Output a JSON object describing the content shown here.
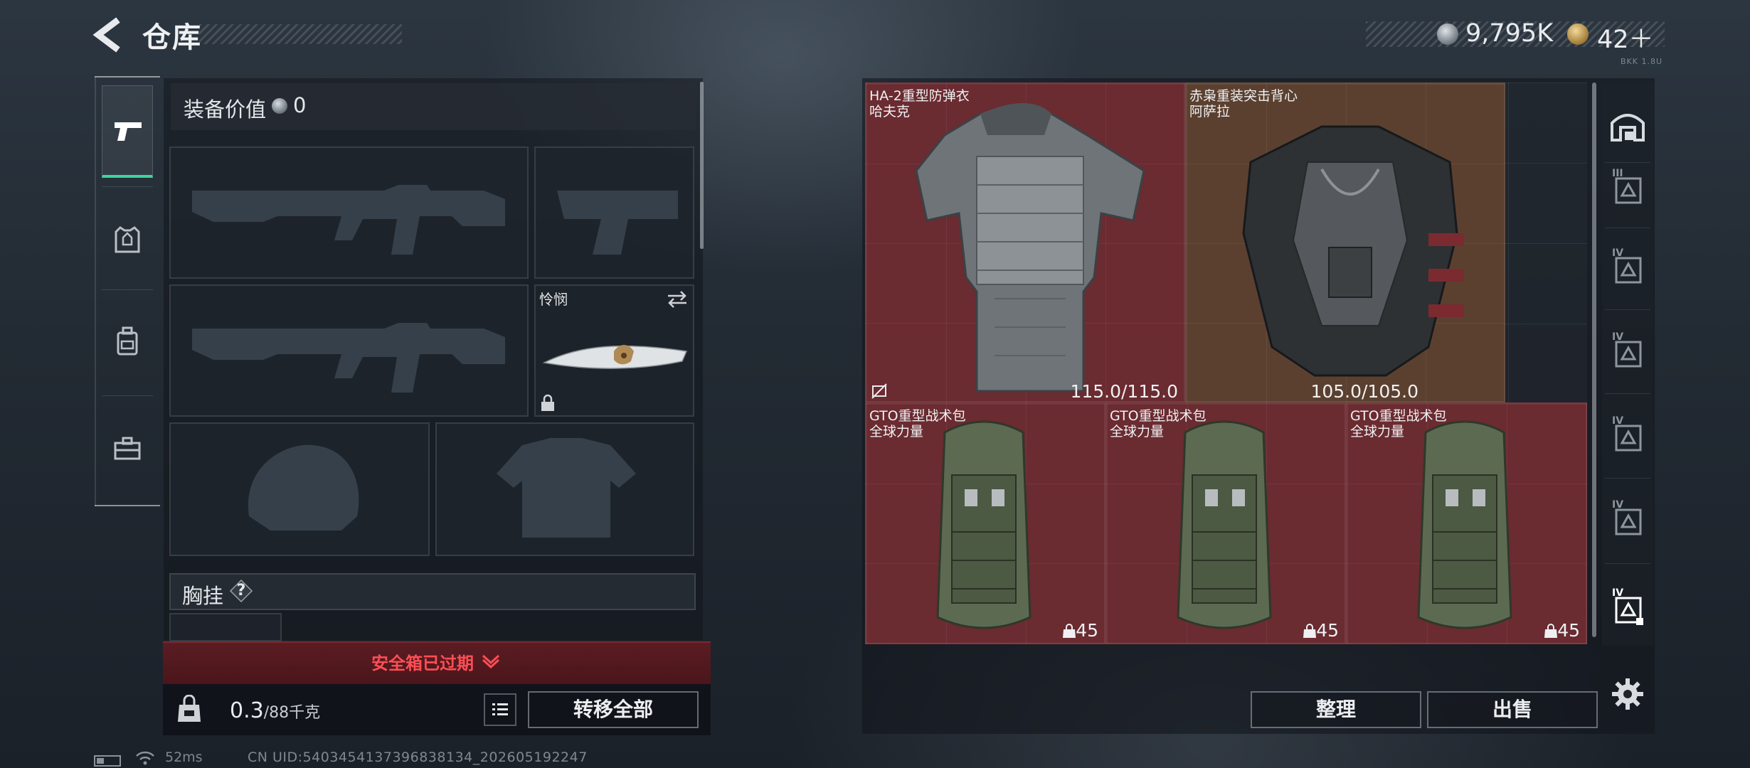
{
  "header": {
    "title": "仓库",
    "currency_silver": "9,795K",
    "currency_gold": "42＋",
    "version_tag": "BKK 1.8U"
  },
  "equipment": {
    "value_label": "装备价值",
    "value": "0",
    "knife_name": "怜悯",
    "chest_rig_label": "胸挂",
    "chest_rig_help": "?"
  },
  "safe_box": {
    "status": "安全箱已过期"
  },
  "backpack": {
    "weight_current": "0.3",
    "weight_max": "/88千克",
    "transfer_all": "转移全部"
  },
  "storage": {
    "items": [
      {
        "name": "HA-2重型防弹衣",
        "brand": "哈夫克",
        "durability": "115.0/115.0"
      },
      {
        "name": "赤枭重装突击背心",
        "brand": "阿萨拉",
        "durability": "105.0/105.0"
      },
      {
        "name": "GTO重型战术包",
        "brand": "全球力量",
        "capacity": "45"
      },
      {
        "name": "GTO重型战术包",
        "brand": "全球力量",
        "capacity": "45"
      },
      {
        "name": "GTO重型战术包",
        "brand": "全球力量",
        "capacity": "45"
      }
    ],
    "sort_button": "整理",
    "sell_button": "出售"
  },
  "right_tabs": [
    {
      "icon": "stash-icon"
    },
    {
      "icon": "storage-iii-icon",
      "label": "III"
    },
    {
      "icon": "storage-iv-icon",
      "label": "IV"
    },
    {
      "icon": "storage-iv-icon",
      "label": "IV"
    },
    {
      "icon": "storage-iv-icon",
      "label": "IV"
    },
    {
      "icon": "storage-iv-icon",
      "label": "IV"
    },
    {
      "icon": "storage-iv-icon",
      "label": "IV"
    }
  ],
  "status_bar": {
    "ping": "52ms",
    "uid": "CN UID:5403454137396838134_202605192247"
  },
  "colors": {
    "accent_green": "#3fd59e",
    "item_red": "#6a2b31",
    "item_amber": "#5b4030",
    "warning_red": "#ff4e55"
  }
}
